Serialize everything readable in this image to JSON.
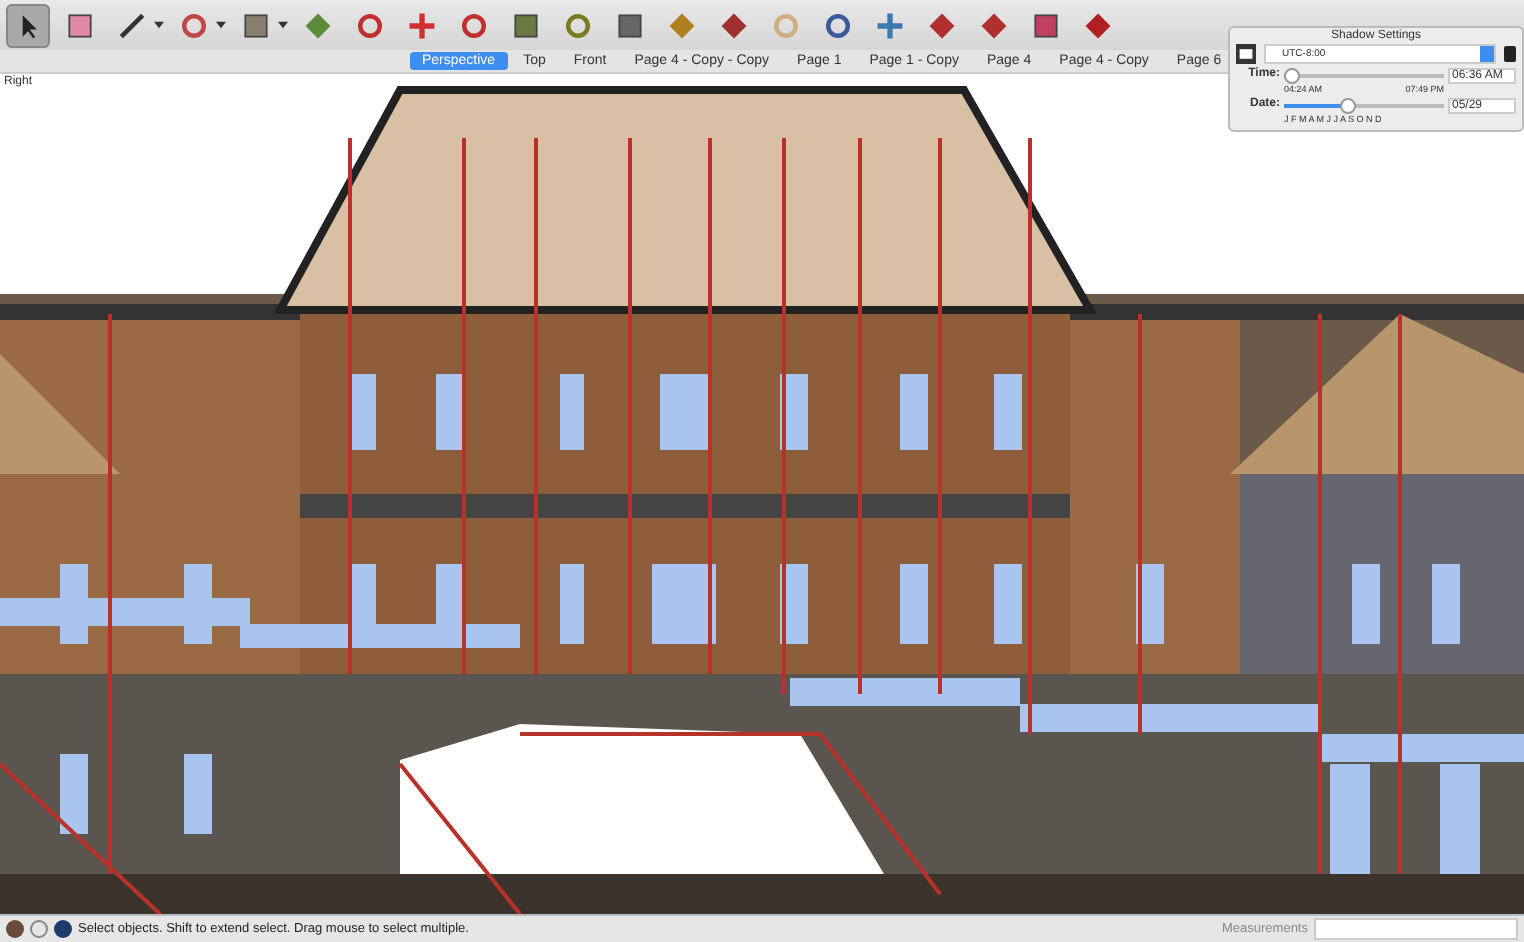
{
  "toolbar": {
    "tools": [
      {
        "selected": true
      },
      {
        "selected": false
      },
      {
        "selected": false
      },
      {
        "selected": false
      },
      {
        "selected": false
      },
      {
        "selected": false
      },
      {
        "selected": false
      },
      {
        "selected": false
      },
      {
        "selected": false
      },
      {
        "selected": false
      },
      {
        "selected": false
      },
      {
        "selected": false
      },
      {
        "selected": false
      },
      {
        "selected": false
      },
      {
        "selected": false
      },
      {
        "selected": false
      },
      {
        "selected": false
      },
      {
        "selected": false
      },
      {
        "selected": false
      },
      {
        "selected": false
      },
      {
        "selected": false
      }
    ]
  },
  "scene_tabs": [
    {
      "label": "Perspective",
      "selected": true
    },
    {
      "label": "Top",
      "selected": false
    },
    {
      "label": "Front",
      "selected": false
    },
    {
      "label": "Page 4 - Copy - Copy",
      "selected": false
    },
    {
      "label": "Page 1",
      "selected": false
    },
    {
      "label": "Page 1 - Copy",
      "selected": false
    },
    {
      "label": "Page 4",
      "selected": false
    },
    {
      "label": "Page 4 - Copy",
      "selected": false
    },
    {
      "label": "Page 6",
      "selected": false
    }
  ],
  "viewport": {
    "view_label": "Right"
  },
  "shadow_settings": {
    "title": "Shadow Settings",
    "timezone": "UTC-8:00",
    "time": {
      "label": "Time:",
      "level": 0.05,
      "min": "04:24 AM",
      "max": "07:49 PM",
      "value": "06:36 AM"
    },
    "date": {
      "label": "Date:",
      "level": 0.4,
      "months": "J F M A M J J A S O N D",
      "value": "05/29"
    }
  },
  "status_bar": {
    "message": "Select objects. Shift to extend select. Drag mouse to select multiple.",
    "measurements_label": "Measurements"
  }
}
